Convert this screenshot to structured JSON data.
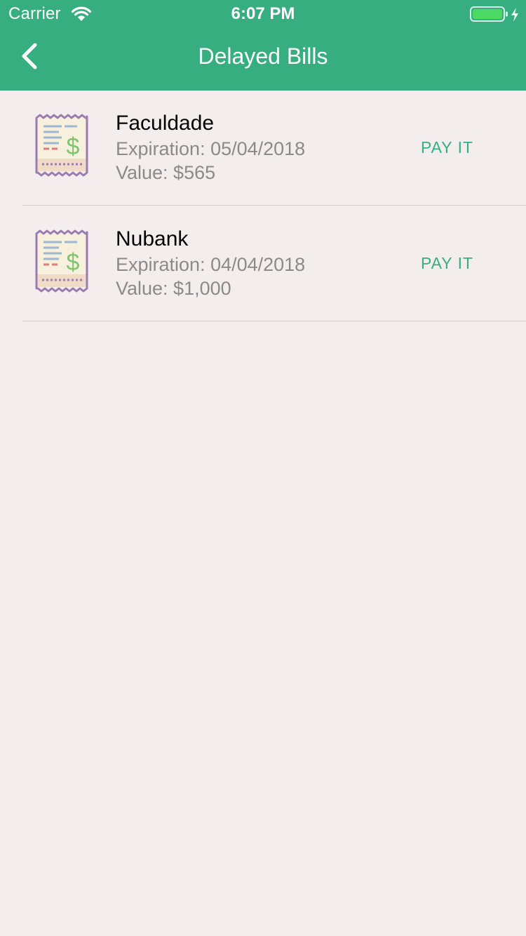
{
  "status_bar": {
    "carrier": "Carrier",
    "time": "6:07 PM",
    "wifi_icon": "wifi-icon",
    "battery_icon": "battery-charging-icon"
  },
  "nav": {
    "title": "Delayed Bills",
    "back_icon": "chevron-left-icon"
  },
  "colors": {
    "primary": "#37ae7f",
    "background": "#f3eeed",
    "text_primary": "#000000",
    "text_secondary": "#8b8a8a",
    "divider": "#d4cfce"
  },
  "bills": [
    {
      "icon": "receipt-dollar-icon",
      "name": "Faculdade",
      "expiration": "Expiration: 05/04/2018",
      "value": "Value: $565",
      "action_label": "PAY IT"
    },
    {
      "icon": "receipt-dollar-icon",
      "name": "Nubank",
      "expiration": "Expiration: 04/04/2018",
      "value": "Value: $1,000",
      "action_label": "PAY IT"
    }
  ]
}
